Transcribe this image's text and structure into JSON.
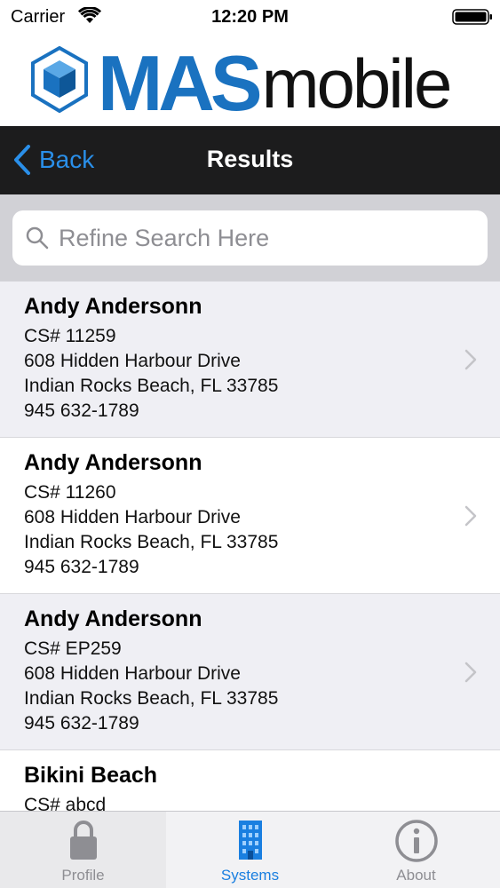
{
  "status_bar": {
    "carrier": "Carrier",
    "time": "12:20 PM"
  },
  "header": {
    "logo_bold": "MAS",
    "logo_light": "mobile",
    "brand_color": "#1a72c0"
  },
  "nav": {
    "back_label": "Back",
    "title": "Results",
    "accent": "#2a8fe9"
  },
  "search": {
    "placeholder": "Refine Search Here",
    "value": ""
  },
  "results": [
    {
      "name": "Andy Andersonn",
      "cs": "CS# 11259",
      "address": "608 Hidden Harbour Drive",
      "city": "Indian Rocks Beach, FL 33785",
      "phone": "945 632-1789"
    },
    {
      "name": "Andy Andersonn",
      "cs": "CS# 11260",
      "address": "608 Hidden Harbour Drive",
      "city": "Indian Rocks Beach, FL 33785",
      "phone": "945 632-1789"
    },
    {
      "name": "Andy Andersonn",
      "cs": "CS# EP259",
      "address": "608 Hidden Harbour Drive",
      "city": "Indian Rocks Beach, FL 33785",
      "phone": "945 632-1789"
    },
    {
      "name": "Bikini Beach",
      "cs": "CS# abcd",
      "address": "",
      "city": "",
      "phone": ""
    }
  ],
  "tabs": [
    {
      "label": "Profile",
      "icon": "lock-icon",
      "active": false
    },
    {
      "label": "Systems",
      "icon": "building-icon",
      "active": true
    },
    {
      "label": "About",
      "icon": "info-icon",
      "active": false
    }
  ],
  "colors": {
    "tab_active": "#1a7fe0",
    "tab_inactive": "#8e8e93"
  }
}
